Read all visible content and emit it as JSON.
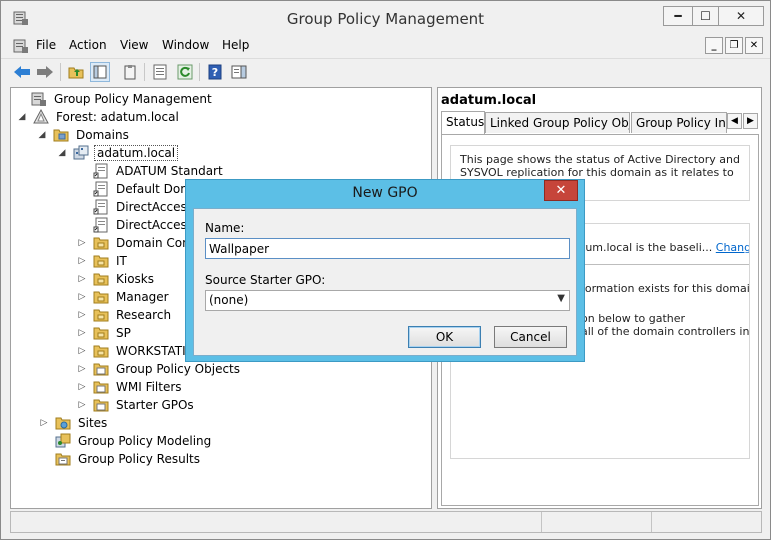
{
  "window": {
    "title": "Group Policy Management"
  },
  "menu": {
    "items": [
      "File",
      "Action",
      "View",
      "Window",
      "Help"
    ]
  },
  "toolbar": {
    "icons": [
      "back-icon",
      "forward-icon",
      "up-folder-icon",
      "show-hide-tree-icon",
      "clipboard-icon",
      "properties-icon",
      "refresh-icon",
      "help-icon",
      "action-pane-icon"
    ]
  },
  "tree": {
    "items": [
      {
        "label": "Group Policy Management",
        "icon": "gpm-icon"
      },
      {
        "label": "Forest: adatum.local",
        "icon": "forest-icon"
      },
      {
        "label": "Domains",
        "icon": "domains-folder-icon"
      },
      {
        "label": "adatum.local",
        "icon": "domain-icon"
      },
      {
        "label": "ADATUM Standart",
        "icon": "gpo-link-icon"
      },
      {
        "label": "Default Domain Policy",
        "icon": "gpo-link-icon"
      },
      {
        "label": "DirectAccess Client Settings",
        "icon": "gpo-link-icon"
      },
      {
        "label": "DirectAccess Server Settings",
        "icon": "gpo-link-icon"
      },
      {
        "label": "Domain Controllers",
        "icon": "ou-folder-icon"
      },
      {
        "label": "IT",
        "icon": "ou-folder-icon"
      },
      {
        "label": "Kiosks",
        "icon": "ou-folder-icon"
      },
      {
        "label": "Manager",
        "icon": "ou-folder-icon"
      },
      {
        "label": "Research",
        "icon": "ou-folder-icon"
      },
      {
        "label": "SP",
        "icon": "ou-folder-icon"
      },
      {
        "label": "WORKSTATIONS",
        "icon": "ou-folder-icon"
      },
      {
        "label": "Group Policy Objects",
        "icon": "folder-icon"
      },
      {
        "label": "WMI Filters",
        "icon": "folder-icon"
      },
      {
        "label": "Starter GPOs",
        "icon": "folder-icon"
      },
      {
        "label": "Sites",
        "icon": "sites-icon"
      },
      {
        "label": "Group Policy Modeling",
        "icon": "modeling-icon"
      },
      {
        "label": "Group Policy Results",
        "icon": "results-icon"
      }
    ]
  },
  "right": {
    "title": "adatum.local",
    "tabs": [
      "Status",
      "Linked Group Policy Objects",
      "Group Policy Inher"
    ],
    "status_intro": "This page shows the status of Active Directory and SYSVOL replication for this domain as it relates to Group",
    "baseline_text": "tum.local is the baseli...",
    "change_link": "Change",
    "info_line": "formation exists for this domain.",
    "gather_line1": "on below to gather",
    "gather_line2": "all of the domain controllers in"
  },
  "dialog": {
    "title": "New GPO",
    "name_label": "Name:",
    "name_value": "Wallpaper",
    "starter_label": "Source Starter GPO:",
    "starter_value": "(none)",
    "ok_label": "OK",
    "cancel_label": "Cancel"
  }
}
